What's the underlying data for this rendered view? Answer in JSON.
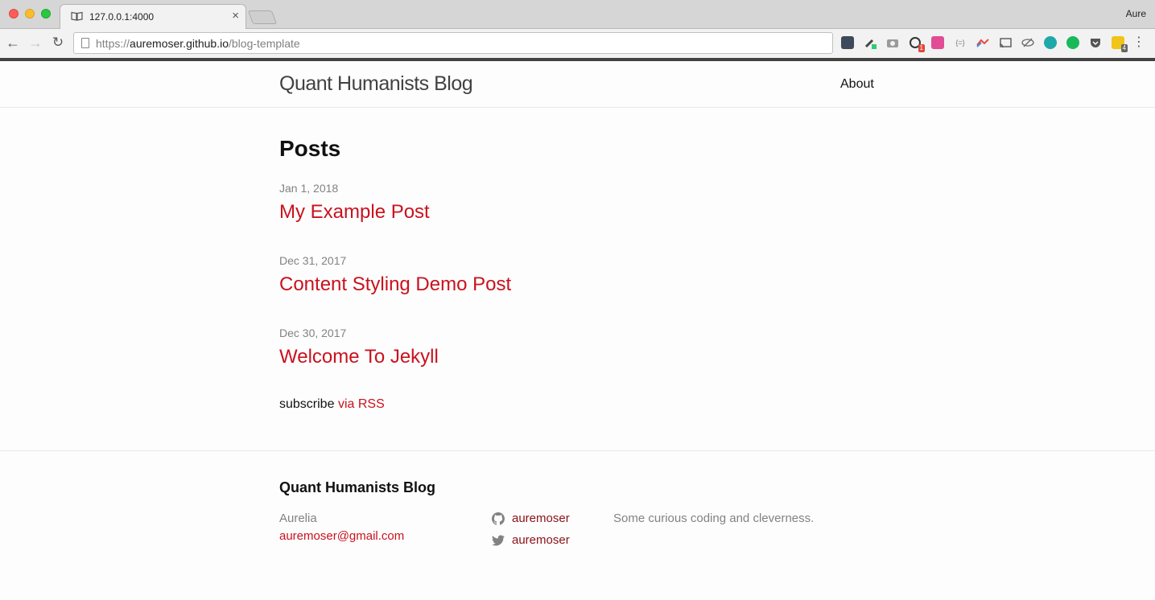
{
  "browser": {
    "tab_title": "127.0.0.1:4000",
    "tab_close": "×",
    "profile_name": "Aure",
    "url_prefix": "https://",
    "url_domain": "auremoser.github.io",
    "url_path": "/blog-template",
    "extension_badges": {
      "ext3": "1",
      "ext17": "4"
    },
    "menu": "⋮"
  },
  "header": {
    "site_title": "Quant Humanists Blog",
    "nav_about": "About"
  },
  "main": {
    "heading": "Posts",
    "posts": [
      {
        "date": "Jan 1, 2018",
        "title": "My Example Post"
      },
      {
        "date": "Dec 31, 2017",
        "title": "Content Styling Demo Post"
      },
      {
        "date": "Dec 30, 2017",
        "title": "Welcome To Jekyll"
      }
    ],
    "subscribe_text": "subscribe",
    "subscribe_link": "via RSS"
  },
  "footer": {
    "heading": "Quant Humanists Blog",
    "author": "Aurelia",
    "email": "auremoser@gmail.com",
    "github_user": "auremoser",
    "twitter_user": "auremoser",
    "description": "Some curious coding and cleverness."
  },
  "colors": {
    "accent_link": "#c9121e",
    "social_link": "#8a1119",
    "muted_text": "#828282"
  }
}
